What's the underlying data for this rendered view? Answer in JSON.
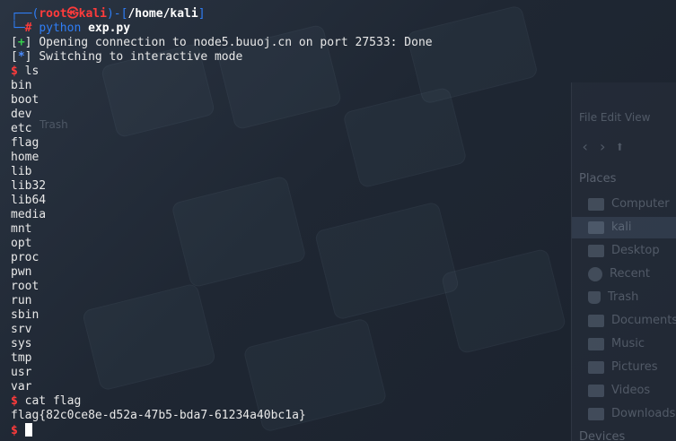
{
  "prompt": {
    "user": "root",
    "skull": "㉿",
    "host": "kali",
    "path": "/home/kali",
    "command_keyword": "python",
    "command_arg": "exp.py"
  },
  "output": [
    {
      "marker": "+",
      "text": "Opening connection to node5.buuoj.cn on port 27533: Done"
    },
    {
      "marker": "*",
      "text": "Switching to interactive mode"
    }
  ],
  "shell": {
    "prompt_symbol": "$",
    "first_command": "ls",
    "listing": [
      "bin",
      "boot",
      "dev",
      "etc",
      "flag",
      "home",
      "lib",
      "lib32",
      "lib64",
      "media",
      "mnt",
      "opt",
      "proc",
      "pwn",
      "root",
      "run",
      "sbin",
      "srv",
      "sys",
      "tmp",
      "usr",
      "var"
    ],
    "second_command": "cat flag",
    "flag": "flag{82c0ce8e-d52a-47b5-bda7-61234a40bc1a}"
  },
  "background": {
    "desktop_trash_label": "Trash",
    "file_manager": {
      "toolbar": "File  Edit  View",
      "nav_icons": "‹ › ⬆",
      "places_heading": "Places",
      "places": [
        "Computer",
        "kali",
        "Desktop",
        "Recent",
        "Trash",
        "Documents",
        "Music",
        "Pictures",
        "Videos",
        "Downloads"
      ],
      "devices_heading": "Devices"
    }
  },
  "colors": {
    "prompt_frame": "#2f7ef6",
    "root_and_dollar": "#ff3b3b",
    "plus_marker": "#35d04c",
    "star_marker": "#4a8cff",
    "text": "#e8e8e8",
    "background": "#202835"
  }
}
